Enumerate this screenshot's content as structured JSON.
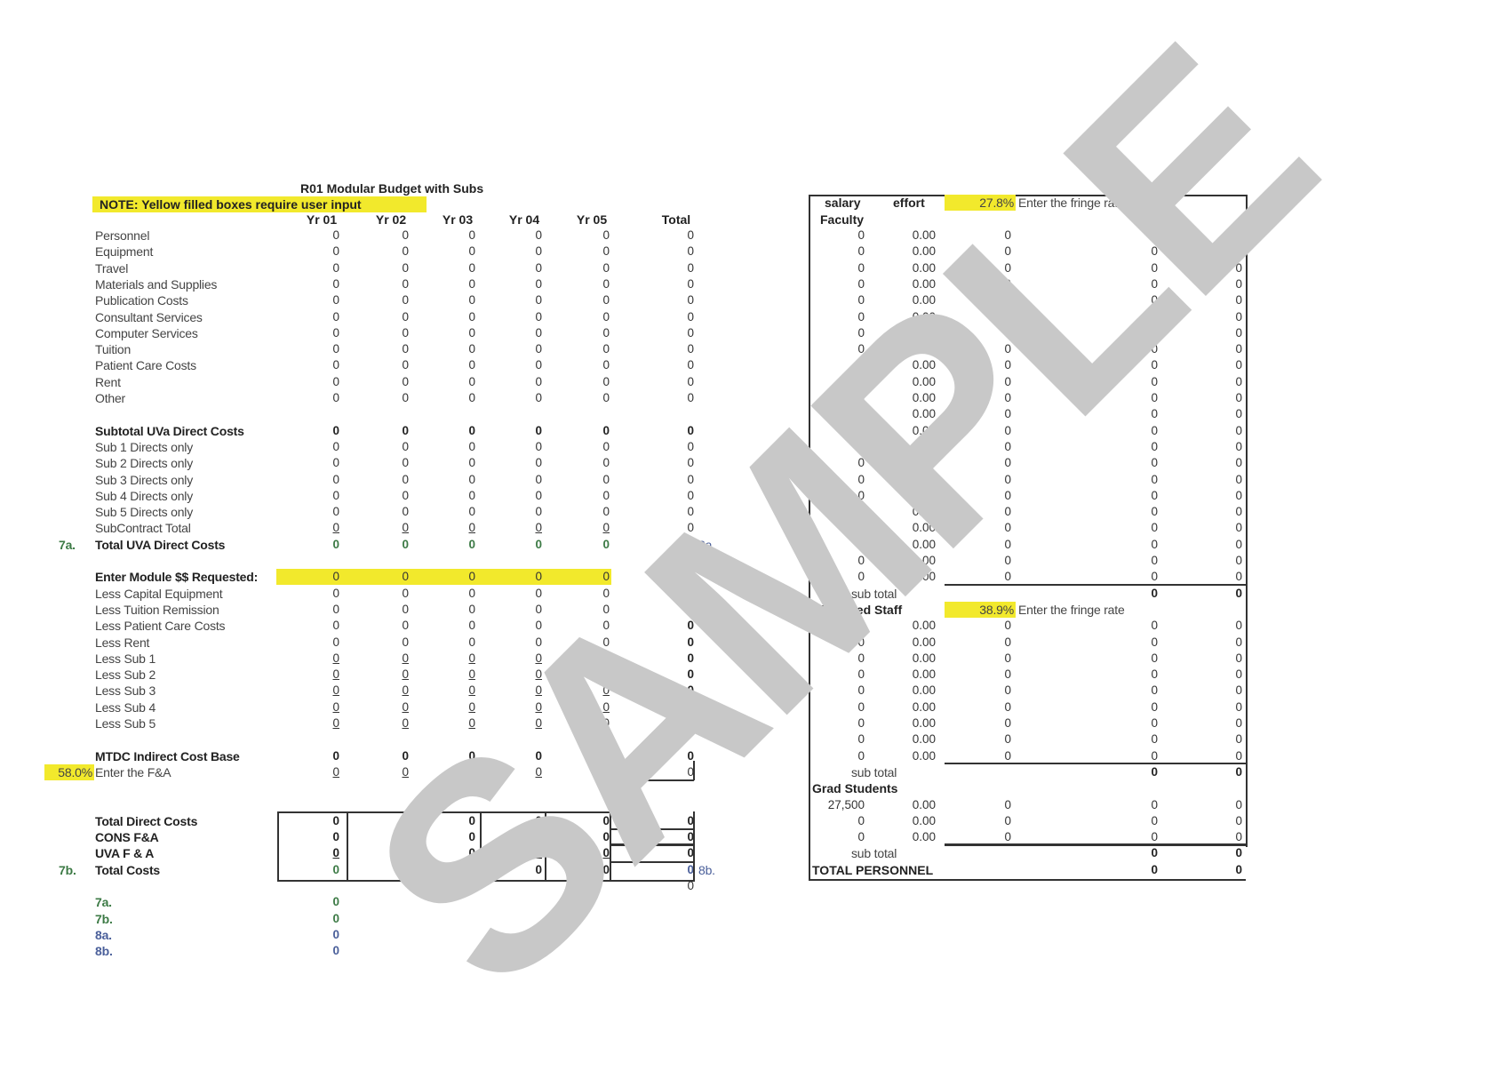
{
  "title": "R01 Modular Budget with Subs",
  "note": "NOTE:  Yellow filled boxes require user input",
  "columns": [
    "Yr 01",
    "Yr 02",
    "Yr 03",
    "Yr 04",
    "Yr 05",
    "Total"
  ],
  "direct_rows": [
    {
      "label": "Personnel",
      "values": [
        "0",
        "0",
        "0",
        "0",
        "0",
        "0"
      ]
    },
    {
      "label": "Equipment",
      "values": [
        "0",
        "0",
        "0",
        "0",
        "0",
        "0"
      ]
    },
    {
      "label": "Travel",
      "values": [
        "0",
        "0",
        "0",
        "0",
        "0",
        "0"
      ]
    },
    {
      "label": "Materials and Supplies",
      "values": [
        "0",
        "0",
        "0",
        "0",
        "0",
        "0"
      ]
    },
    {
      "label": "Publication Costs",
      "values": [
        "0",
        "0",
        "0",
        "0",
        "0",
        "0"
      ]
    },
    {
      "label": "Consultant Services",
      "values": [
        "0",
        "0",
        "0",
        "0",
        "0",
        "0"
      ]
    },
    {
      "label": "Computer Services",
      "values": [
        "0",
        "0",
        "0",
        "0",
        "0",
        "0"
      ]
    },
    {
      "label": "Tuition",
      "values": [
        "0",
        "0",
        "0",
        "0",
        "0",
        "0"
      ]
    },
    {
      "label": "Patient Care Costs",
      "values": [
        "0",
        "0",
        "0",
        "0",
        "0",
        "0"
      ]
    },
    {
      "label": "Rent",
      "values": [
        "0",
        "0",
        "0",
        "0",
        "0",
        "0"
      ]
    },
    {
      "label": "Other",
      "values": [
        "0",
        "0",
        "0",
        "0",
        "0",
        "0"
      ]
    }
  ],
  "subtotal": {
    "label": "Subtotal UVa Direct Costs",
    "values": [
      "0",
      "0",
      "0",
      "0",
      "0",
      "0"
    ]
  },
  "sub_rows": [
    {
      "label": "Sub 1 Directs only",
      "values": [
        "0",
        "0",
        "0",
        "0",
        "0",
        "0"
      ]
    },
    {
      "label": "Sub 2 Directs only",
      "values": [
        "0",
        "0",
        "0",
        "0",
        "0",
        "0"
      ]
    },
    {
      "label": "Sub 3 Directs only",
      "values": [
        "0",
        "0",
        "0",
        "0",
        "0",
        "0"
      ]
    },
    {
      "label": "Sub 4 Directs only",
      "values": [
        "0",
        "0",
        "0",
        "0",
        "0",
        "0"
      ]
    },
    {
      "label": "Sub 5 Directs only",
      "values": [
        "0",
        "0",
        "0",
        "0",
        "0",
        "0"
      ]
    }
  ],
  "subcontract_total": {
    "label": "SubContract Total",
    "values": [
      "0",
      "0",
      "0",
      "0",
      "0",
      "0"
    ]
  },
  "total_uva_direct": {
    "marker": "7a.",
    "label": "Total UVA Direct Costs",
    "values": [
      "0",
      "0",
      "0",
      "0",
      "0",
      "0"
    ],
    "right_marker": "8a."
  },
  "module": {
    "label": "Enter Module $$ Requested:",
    "values": [
      "0",
      "0",
      "0",
      "0",
      "0",
      "0"
    ]
  },
  "less_rows": [
    {
      "label": "Less Capital Equipment",
      "values": [
        "0",
        "0",
        "0",
        "0",
        "0",
        "0"
      ]
    },
    {
      "label": "Less Tuition Remission",
      "values": [
        "0",
        "0",
        "0",
        "0",
        "0",
        "0"
      ]
    },
    {
      "label": "Less Patient Care Costs",
      "values": [
        "0",
        "0",
        "0",
        "0",
        "0",
        "0"
      ]
    },
    {
      "label": "Less Rent",
      "values": [
        "0",
        "0",
        "0",
        "0",
        "0",
        "0"
      ]
    },
    {
      "label": "Less Sub 1",
      "values": [
        "0",
        "0",
        "0",
        "0",
        "0",
        "0"
      ]
    },
    {
      "label": "Less Sub 2",
      "values": [
        "0",
        "0",
        "0",
        "0",
        "0",
        "0"
      ]
    },
    {
      "label": "Less Sub 3",
      "values": [
        "0",
        "0",
        "0",
        "0",
        "0",
        "0"
      ]
    },
    {
      "label": "Less Sub 4",
      "values": [
        "0",
        "0",
        "0",
        "0",
        "0",
        "0"
      ]
    },
    {
      "label": "Less Sub 5",
      "values": [
        "0",
        "0",
        "0",
        "0",
        "0",
        "0"
      ]
    }
  ],
  "mtdc": {
    "label": "MTDC Indirect Cost Base",
    "values": [
      "0",
      "0",
      "0",
      "0",
      "0",
      "0"
    ]
  },
  "fa": {
    "rate": "58.0%",
    "label": "Enter the F&A",
    "values": [
      "0",
      "0",
      "0",
      "0",
      "0",
      "0"
    ]
  },
  "totals": [
    {
      "label": "Total Direct Costs",
      "values": [
        "0",
        "0",
        "0",
        "0",
        "0",
        "0"
      ]
    },
    {
      "label": "CONS F&A",
      "values": [
        "0",
        "0",
        "0",
        "0",
        "0",
        "0"
      ]
    },
    {
      "label": "UVA F & A",
      "values": [
        "0",
        "0",
        "0",
        "0",
        "0",
        "0"
      ]
    },
    {
      "marker": "7b.",
      "label": "Total Costs",
      "values": [
        "0",
        "0",
        "0",
        "0",
        "0",
        "0"
      ],
      "right_marker": "8b."
    }
  ],
  "extra_total": "0",
  "summary": [
    {
      "label": "7a.",
      "value": "0",
      "color": "#3c7a45"
    },
    {
      "label": "7b.",
      "value": "0",
      "color": "#3c7a45"
    },
    {
      "label": "8a.",
      "value": "0",
      "color": "#4a5f9a"
    },
    {
      "label": "8b.",
      "value": "0",
      "color": "#4a5f9a"
    }
  ],
  "personnel": {
    "headers": {
      "salary": "salary",
      "effort": "effort"
    },
    "faculty": {
      "title": "Faculty",
      "fringe_rate": "27.8%",
      "fringe_label": "Enter the fringe rate",
      "rows": 22,
      "row": [
        "0",
        "0.00",
        "0",
        "0",
        "0"
      ],
      "subtotal_label": "sub total",
      "subtotal": [
        "0",
        "0"
      ]
    },
    "classified": {
      "title": "Classified Staff",
      "fringe_rate": "38.9%",
      "fringe_label": "Enter the fringe rate",
      "rows": 9,
      "row": [
        "0",
        "0.00",
        "0",
        "0",
        "0"
      ],
      "subtotal_label": "sub total",
      "subtotal": [
        "0",
        "0"
      ]
    },
    "grad": {
      "title": "Grad Students",
      "rows_data": [
        [
          "27,500",
          "0.00",
          "0",
          "0",
          "0"
        ],
        [
          "0",
          "0.00",
          "0",
          "0",
          "0"
        ],
        [
          "0",
          "0.00",
          "0",
          "0",
          "0"
        ]
      ],
      "subtotal_label": "sub total",
      "subtotal": [
        "0",
        "0"
      ]
    },
    "total_label": "TOTAL PERSONNEL",
    "total": [
      "0",
      "0"
    ]
  },
  "watermark": "SAMPLE",
  "colors": {
    "yellow": "#f2e92c",
    "green": "#3c7a45",
    "blue": "#4a5f9a",
    "watermark": "#c8c8c8"
  }
}
